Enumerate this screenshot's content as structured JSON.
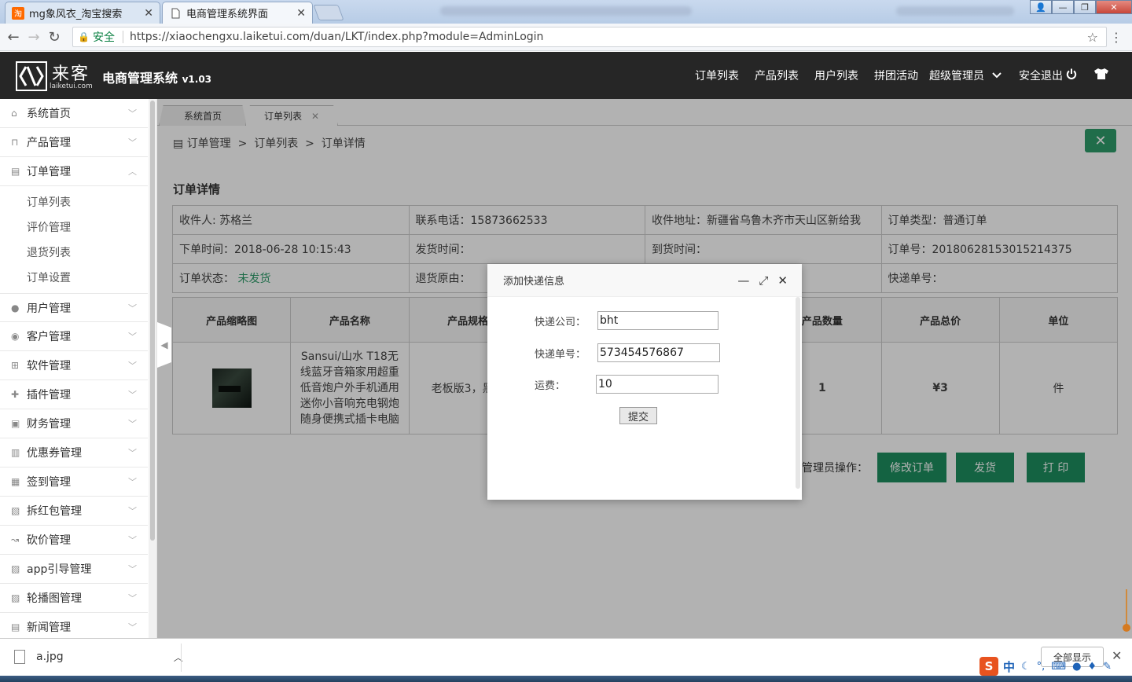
{
  "browser": {
    "tabs": [
      {
        "title": "mg象风衣_淘宝搜索",
        "favicon": "淘"
      },
      {
        "title": "电商管理系统界面",
        "favicon": "doc"
      }
    ],
    "address": {
      "secure_label": "安全",
      "url": "https://xiaochengxu.laiketui.com/duan/LKT/index.php?module=AdminLogin"
    }
  },
  "header": {
    "logo_text": "来客",
    "logo_sub": "laiketui.com",
    "title": "电商管理系统",
    "version": "v1.03",
    "nav": [
      "订单列表",
      "产品列表",
      "用户列表",
      "拼团活动",
      "超级管理员",
      "安全退出"
    ]
  },
  "sidebar": {
    "items": [
      {
        "label": "系统首页",
        "icon": "home-icon"
      },
      {
        "label": "产品管理",
        "icon": "bag-icon"
      },
      {
        "label": "订单管理",
        "icon": "list-icon",
        "expanded": true,
        "sub": [
          "订单列表",
          "评价管理",
          "退货列表",
          "订单设置"
        ]
      },
      {
        "label": "用户管理",
        "icon": "user-icon"
      },
      {
        "label": "客户管理",
        "icon": "customer-icon"
      },
      {
        "label": "软件管理",
        "icon": "grid-icon"
      },
      {
        "label": "插件管理",
        "icon": "puzzle-icon"
      },
      {
        "label": "财务管理",
        "icon": "finance-icon"
      },
      {
        "label": "优惠券管理",
        "icon": "coupon-icon"
      },
      {
        "label": "签到管理",
        "icon": "sign-icon"
      },
      {
        "label": "拆红包管理",
        "icon": "redpacket-icon"
      },
      {
        "label": "砍价管理",
        "icon": "bargain-icon"
      },
      {
        "label": "app引导管理",
        "icon": "image-icon"
      },
      {
        "label": "轮播图管理",
        "icon": "image-icon"
      },
      {
        "label": "新闻管理",
        "icon": "news-icon"
      }
    ]
  },
  "content": {
    "tabs": [
      {
        "label": "系统首页"
      },
      {
        "label": "订单列表"
      }
    ],
    "breadcrumb": [
      "订单管理",
      "订单列表",
      "订单详情"
    ],
    "section_title": "订单详情",
    "info": {
      "row1": [
        "收件人: 苏格兰",
        "联系电话：15873662533",
        "收件地址：新疆省乌鲁木齐市天山区新给我",
        "订单类型：普通订单"
      ],
      "row2": [
        "下单时间：2018-06-28 10:15:43",
        "发货时间：",
        "到货时间：",
        "订单号：2018062815301521437​5"
      ],
      "row3_status_label": "订单状态：",
      "row3_status_value": "未发货",
      "row3": [
        "退货原由：",
        "",
        "快递单号："
      ]
    },
    "product_table": {
      "headers": [
        "产品缩略图",
        "产品名称",
        "产品规格",
        "",
        "",
        "产品数量",
        "产品总价",
        "单位"
      ],
      "row": {
        "name": "Sansui/山水 T18无线蓝牙音箱家用超重低音炮户外手机通用迷你小音响充电钢炮随身便携式插卡电脑",
        "spec": "老板版3，黑色",
        "quantity": "1",
        "total": "¥3",
        "unit": "件"
      }
    },
    "admin_ops_label": "管理员操作：",
    "buttons": [
      "修改订单",
      "发货",
      "打 印"
    ]
  },
  "modal": {
    "title": "添加快递信息",
    "fields": [
      {
        "label": "快递公司：",
        "value": "bht"
      },
      {
        "label": "快递单号：",
        "value": "573454576867"
      },
      {
        "label": "运费：",
        "value": "10"
      }
    ],
    "submit": "提交"
  },
  "downloads": {
    "file": "a.jpg",
    "show_all": "全部显示"
  },
  "colors": {
    "header_bg": "#262626",
    "accent_green": "#1e8e5f",
    "status_green": "#2e9c6a"
  }
}
